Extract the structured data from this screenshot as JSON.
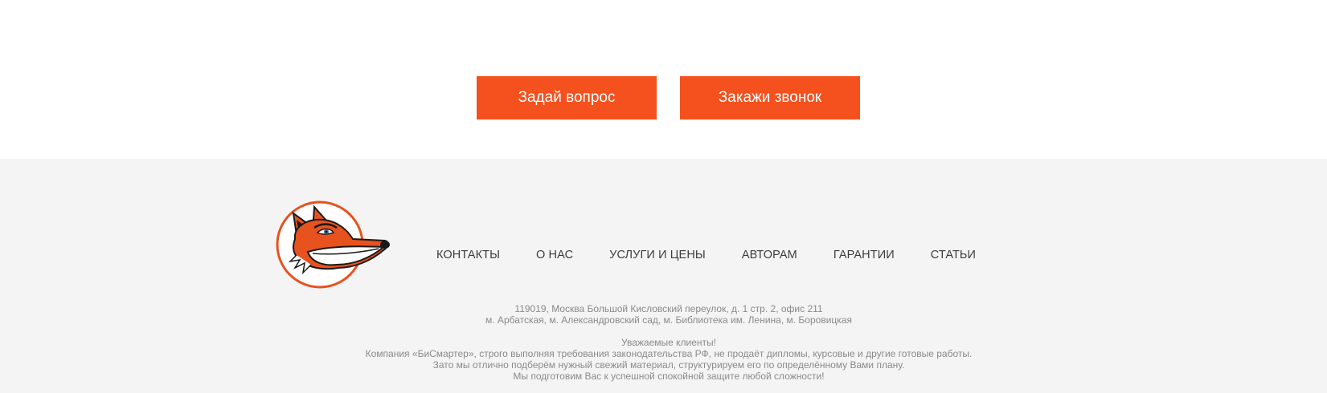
{
  "actions": {
    "ask_label": "Задай вопрос",
    "call_label": "Закажи звонок"
  },
  "footer": {
    "nav": [
      "КОНТАКТЫ",
      "О НАС",
      "УСЛУГИ И ЦЕНЫ",
      "АВТОРАМ",
      "ГАРАНТИИ",
      "СТАТЬИ"
    ],
    "address_line1": "119019, Москва Большой Кисловский переулок, д. 1 стр. 2, офис 211",
    "address_line2": "м. Арбатская, м. Александровский сад, м. Библиотека им. Ленина, м. Боровицкая",
    "notice_title": "Уважаемые клиенты!",
    "notice_line1": "Компания «БиСмартер», строго выполняя требования законодательства РФ, не продаёт дипломы, курсовые и другие готовые работы.",
    "notice_line2": "Зато мы отлично подберём нужный свежий материал, структурируем его по определённому Вами плану.",
    "notice_line3": "Мы подготовим Вас к успешной спокойной защите любой сложности!"
  },
  "colors": {
    "accent": "#f4511e",
    "footer_bg": "#f4f4f4",
    "nav_text": "#3c3c3c",
    "info_text": "#8a8a8a"
  },
  "icons": {
    "logo": "fox-logo-icon"
  }
}
